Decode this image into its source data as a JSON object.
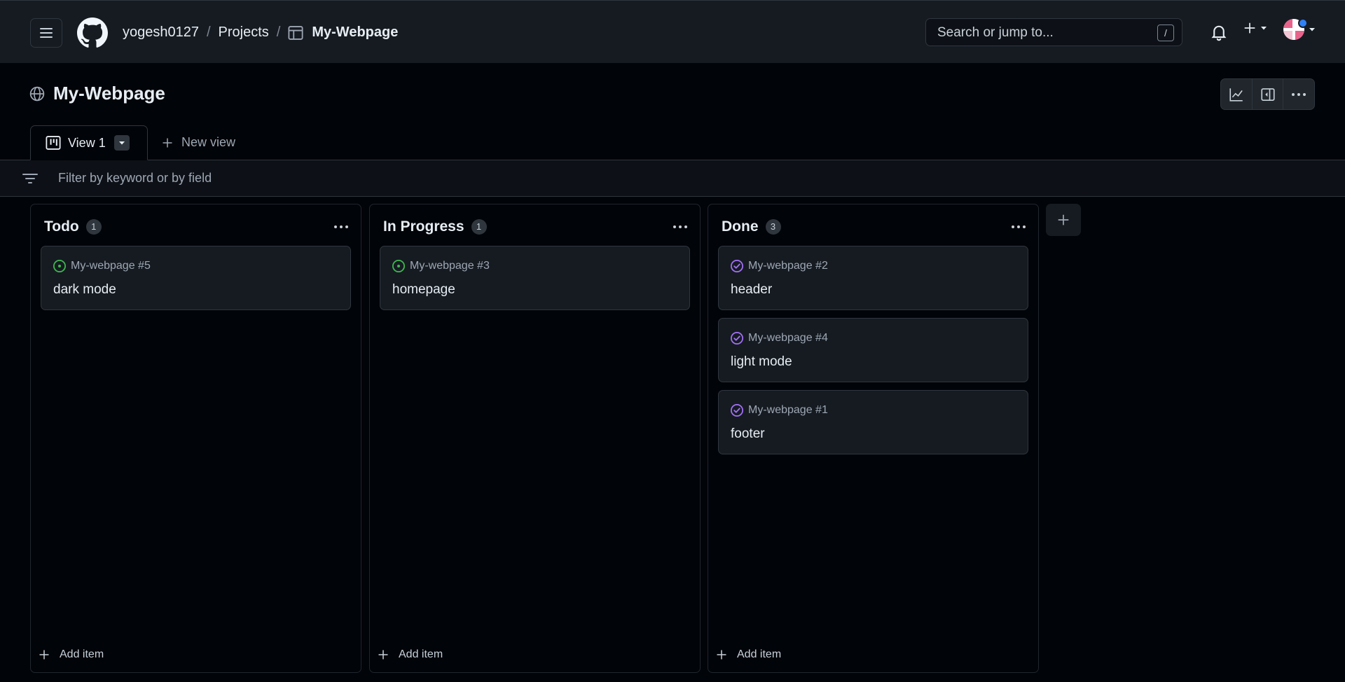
{
  "header": {
    "user": "yogesh0127",
    "projects_crumb": "Projects",
    "current": "My-Webpage",
    "search_placeholder": "Search or jump to...",
    "slash_key": "/"
  },
  "project": {
    "title": "My-Webpage"
  },
  "tabs": {
    "active": "View 1",
    "new_view": "New view"
  },
  "filter": {
    "placeholder": "Filter by keyword or by field"
  },
  "board": {
    "add_item": "Add item",
    "columns": [
      {
        "title": "Todo",
        "count": "1",
        "cards": [
          {
            "ref": "My-webpage #5",
            "title": "dark mode",
            "state": "open"
          }
        ]
      },
      {
        "title": "In Progress",
        "count": "1",
        "cards": [
          {
            "ref": "My-webpage #3",
            "title": "homepage",
            "state": "open"
          }
        ]
      },
      {
        "title": "Done",
        "count": "3",
        "cards": [
          {
            "ref": "My-webpage #2",
            "title": "header",
            "state": "closed"
          },
          {
            "ref": "My-webpage #4",
            "title": "light mode",
            "state": "closed"
          },
          {
            "ref": "My-webpage #1",
            "title": "footer",
            "state": "closed"
          }
        ]
      }
    ]
  },
  "colors": {
    "open": "#3fb950",
    "closed": "#a371f7"
  },
  "icons": {
    "menu": "hamburger-icon",
    "logo": "github-logo",
    "project": "table-icon",
    "search": "slash-key",
    "notifications": "bell-icon",
    "create": "plus-icon",
    "globe": "globe-icon",
    "insights": "graph-icon",
    "panel": "sidebar-icon",
    "more": "kebab-icon",
    "board": "board-icon",
    "filter": "filter-icon"
  }
}
